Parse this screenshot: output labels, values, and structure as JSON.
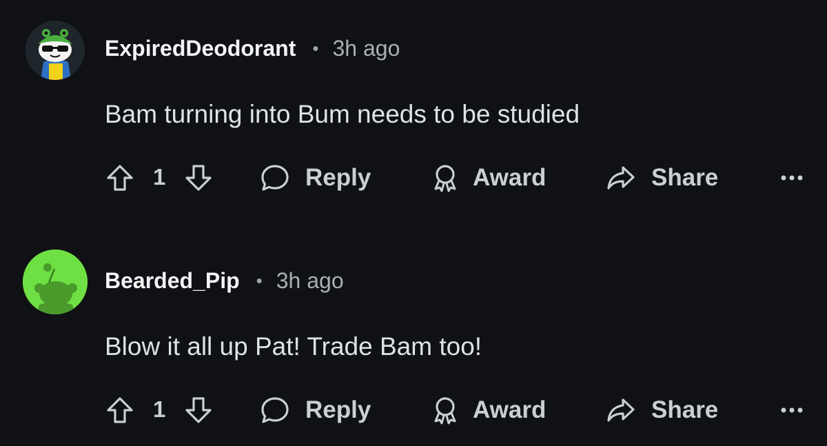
{
  "comments": [
    {
      "username": "ExpiredDeodorant",
      "separator": "•",
      "time": "3h ago",
      "text": "Bam turning into Bum needs to be studied",
      "votes": "1",
      "reply_label": "Reply",
      "award_label": "Award",
      "share_label": "Share",
      "avatar_icon": "snoo-frog-hat-sunglasses-avatar"
    },
    {
      "username": "Bearded_Pip",
      "separator": "•",
      "time": "3h ago",
      "text": "Blow it all up Pat! Trade Bam too!",
      "votes": "1",
      "reply_label": "Reply",
      "award_label": "Award",
      "share_label": "Share",
      "avatar_icon": "default-snoo-green-avatar"
    }
  ],
  "colors": {
    "background": "#0f1114",
    "text_primary": "#f2f4f5",
    "text_secondary": "#a8b0b5",
    "avatar_green": "#6ee043"
  }
}
